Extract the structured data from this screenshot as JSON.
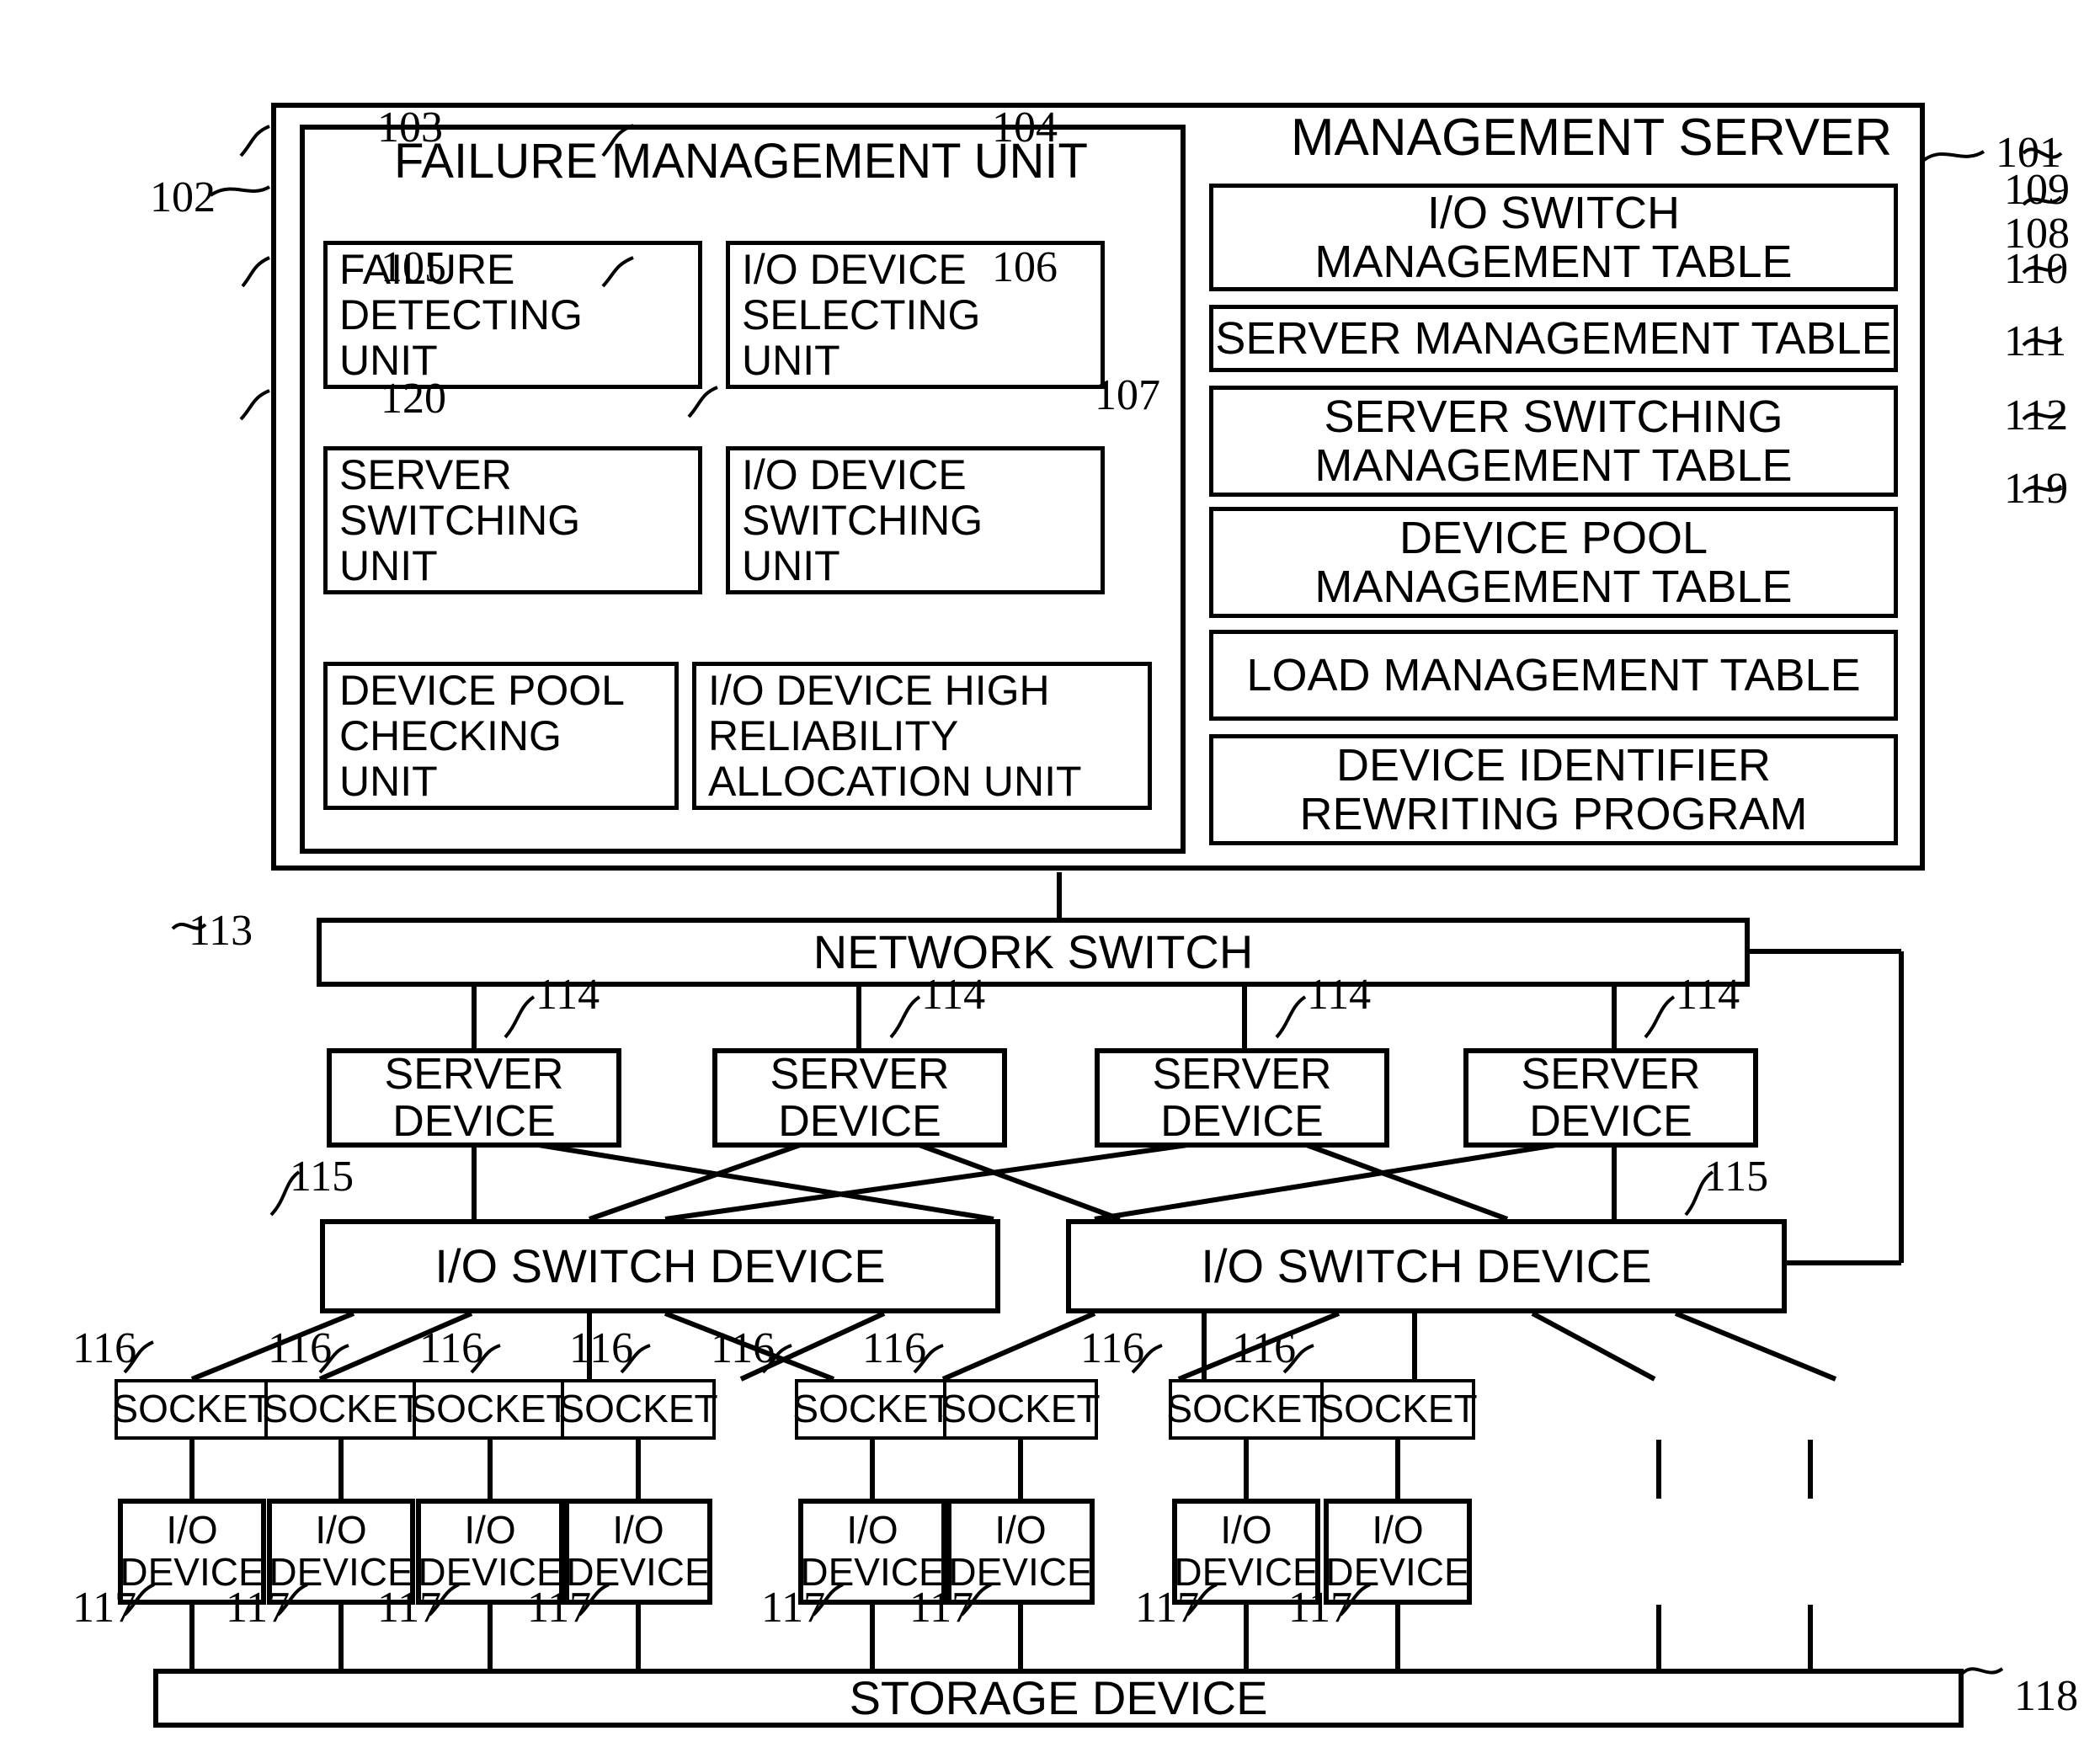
{
  "figure": {
    "outer_container": {
      "label": "MANAGEMENT SERVER",
      "ref": "101"
    },
    "inner_container": {
      "label": "FAILURE MANAGEMENT UNIT",
      "ref": "102"
    },
    "failure_management_units": [
      {
        "label": "FAILURE\nDETECTING\nUNIT",
        "ref": "103"
      },
      {
        "label": "I/O DEVICE\nSELECTING\nUNIT",
        "ref": "104"
      },
      {
        "label": "SERVER\nSWITCHING\nUNIT",
        "ref": "105"
      },
      {
        "label": "I/O DEVICE\nSWITCHING\nUNIT",
        "ref": "106"
      },
      {
        "label": "DEVICE POOL\nCHECKING\nUNIT",
        "ref": "120"
      },
      {
        "label": "I/O DEVICE HIGH\nRELIABILITY\nALLOCATION UNIT",
        "ref": "107"
      }
    ],
    "management_tables": [
      {
        "label": "I/O SWITCH\nMANAGEMENT TABLE",
        "ref": "108"
      },
      {
        "label": "SERVER MANAGEMENT TABLE",
        "ref": "109"
      },
      {
        "label": "SERVER SWITCHING\nMANAGEMENT TABLE",
        "ref": "110"
      },
      {
        "label": "DEVICE POOL\nMANAGEMENT TABLE",
        "ref": "111"
      },
      {
        "label": "LOAD MANAGEMENT TABLE",
        "ref": "112"
      },
      {
        "label": "DEVICE IDENTIFIER\nREWRITING PROGRAM",
        "ref": "119"
      }
    ],
    "network_switch": {
      "label": "NETWORK SWITCH",
      "ref": "113"
    },
    "server_devices": [
      {
        "label": "SERVER\nDEVICE",
        "ref": "114"
      },
      {
        "label": "SERVER\nDEVICE",
        "ref": "114"
      },
      {
        "label": "SERVER\nDEVICE",
        "ref": "114"
      },
      {
        "label": "SERVER\nDEVICE",
        "ref": "114"
      }
    ],
    "io_switch_devices": [
      {
        "label": "I/O SWITCH DEVICE",
        "ref": "115"
      },
      {
        "label": "I/O SWITCH DEVICE",
        "ref": "115"
      }
    ],
    "sockets": [
      {
        "label": "SOCKET",
        "ref": "116"
      },
      {
        "label": "SOCKET",
        "ref": "116"
      },
      {
        "label": "SOCKET",
        "ref": "116"
      },
      {
        "label": "SOCKET",
        "ref": "116"
      },
      {
        "label": "SOCKET",
        "ref": "116"
      },
      {
        "label": "SOCKET",
        "ref": "116"
      },
      {
        "label": "SOCKET",
        "ref": "116"
      },
      {
        "label": "SOCKET",
        "ref": "116"
      }
    ],
    "io_devices": [
      {
        "label": "I/O\nDEVICE",
        "ref": "117"
      },
      {
        "label": "I/O\nDEVICE",
        "ref": "117"
      },
      {
        "label": "I/O\nDEVICE",
        "ref": "117"
      },
      {
        "label": "I/O\nDEVICE",
        "ref": "117"
      },
      {
        "label": "I/O\nDEVICE",
        "ref": "117"
      },
      {
        "label": "I/O\nDEVICE",
        "ref": "117"
      },
      {
        "label": "I/O\nDEVICE",
        "ref": "117"
      },
      {
        "label": "I/O\nDEVICE",
        "ref": "117"
      }
    ],
    "storage_device": {
      "label": "STORAGE DEVICE",
      "ref": "118"
    }
  }
}
